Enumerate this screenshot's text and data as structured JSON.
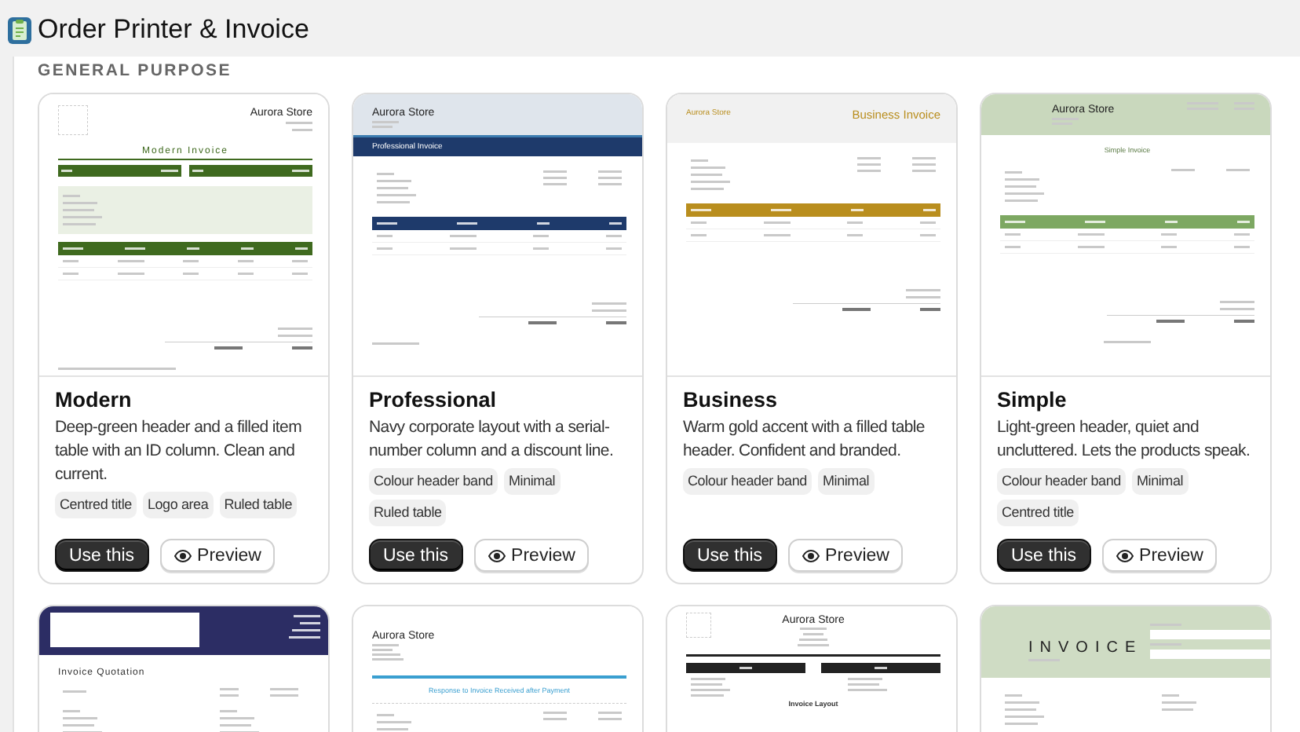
{
  "app": {
    "title": "Order Printer & Invoice"
  },
  "section": {
    "heading": "GENERAL PURPOSE"
  },
  "templates": [
    {
      "name": "Modern",
      "description": "Deep-green header and a filled item table with an ID column. Clean and current.",
      "tags": [
        "Centred title",
        "Logo area",
        "Ruled table"
      ],
      "use_label": "Use this",
      "preview_label": "Preview",
      "preview": {
        "kind": "modern",
        "color": "#3f6a1f",
        "blocks": [
          {
            "kind": "header",
            "logo": true,
            "store": "Aurora Store"
          },
          {
            "kind": "title",
            "text": "Modern Invoice"
          },
          {
            "kind": "bars"
          },
          {
            "kind": "address"
          },
          {
            "kind": "table"
          },
          {
            "kind": "totals"
          },
          {
            "kind": "footer"
          }
        ]
      }
    },
    {
      "name": "Professional",
      "description": "Navy corporate layout with a serial-number column and a discount line.",
      "tags": [
        "Colour header band",
        "Minimal",
        "Ruled table"
      ],
      "use_label": "Use this",
      "preview_label": "Preview",
      "preview": {
        "kind": "professional",
        "color": "#1e3a6b",
        "blocks": [
          {
            "kind": "header",
            "store": "Aurora Store"
          },
          {
            "kind": "title",
            "text": "Professional Invoice"
          },
          {
            "kind": "address",
            "meta": true
          },
          {
            "kind": "table"
          },
          {
            "kind": "totals"
          },
          {
            "kind": "footer"
          }
        ]
      }
    },
    {
      "name": "Business",
      "description": "Warm gold accent with a filled table header. Confident and branded.",
      "tags": [
        "Colour header band",
        "Minimal"
      ],
      "use_label": "Use this",
      "preview_label": "Preview",
      "preview": {
        "kind": "business",
        "color": "#b98e1e",
        "blocks": [
          {
            "kind": "header",
            "store": "Aurora Store",
            "title": "Business Invoice"
          },
          {
            "kind": "address",
            "meta": true
          },
          {
            "kind": "table"
          },
          {
            "kind": "totals"
          }
        ]
      }
    },
    {
      "name": "Simple",
      "description": "Light-green header, quiet and uncluttered. Lets the products speak.",
      "tags": [
        "Colour header band",
        "Minimal",
        "Centred title"
      ],
      "use_label": "Use this",
      "preview_label": "Preview",
      "preview": {
        "kind": "simple",
        "color": "#7da862",
        "blocks": [
          {
            "kind": "header",
            "store": "Aurora Store",
            "meta": true
          },
          {
            "kind": "title",
            "text": "Simple Invoice"
          },
          {
            "kind": "address",
            "meta": true
          },
          {
            "kind": "table"
          },
          {
            "kind": "totals"
          },
          {
            "kind": "footer"
          }
        ]
      }
    },
    {
      "preview": {
        "kind": "quotation",
        "color": "#2c2d64",
        "blocks": [
          {
            "kind": "header",
            "logo": true
          },
          {
            "kind": "title",
            "text": "Invoice Quotation"
          },
          {
            "kind": "address",
            "split": true
          }
        ]
      }
    },
    {
      "preview": {
        "kind": "response",
        "color": "#3a9fd0",
        "blocks": [
          {
            "kind": "header",
            "store": "Aurora Store"
          },
          {
            "kind": "title",
            "text": "Response to Invoice Received after Payment"
          },
          {
            "kind": "address",
            "meta": true
          }
        ]
      }
    },
    {
      "preview": {
        "kind": "layout",
        "color": "#222222",
        "blocks": [
          {
            "kind": "header",
            "logo": true,
            "store": "Aurora Store"
          },
          {
            "kind": "bars"
          },
          {
            "kind": "address",
            "split": true
          },
          {
            "kind": "title",
            "text": "Invoice Layout"
          }
        ]
      }
    },
    {
      "preview": {
        "kind": "bold",
        "color": "#cfdcc4",
        "blocks": [
          {
            "kind": "header",
            "title": "INVOICE",
            "meta": true
          },
          {
            "kind": "address",
            "split": true
          }
        ]
      }
    }
  ]
}
